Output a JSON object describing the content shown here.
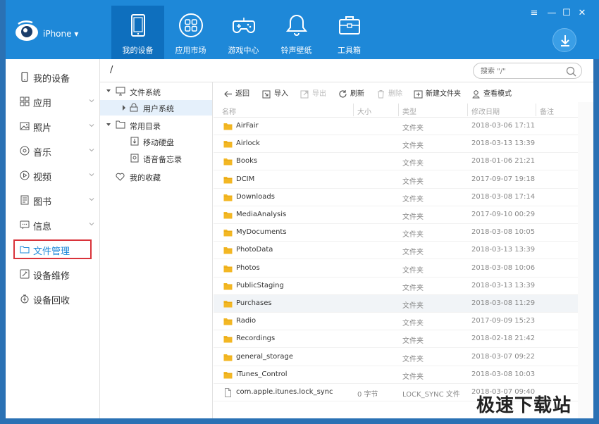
{
  "app": {
    "device_name": "iPhone ▾"
  },
  "nav_tabs": [
    {
      "label": "我的设备",
      "icon": "tablet-icon",
      "active": true
    },
    {
      "label": "应用市场",
      "icon": "apps-icon",
      "active": false
    },
    {
      "label": "游戏中心",
      "icon": "gamepad-icon",
      "active": false
    },
    {
      "label": "铃声壁纸",
      "icon": "bell-icon",
      "active": false
    },
    {
      "label": "工具箱",
      "icon": "toolbox-icon",
      "active": false
    }
  ],
  "window_controls": {
    "menu": "≡",
    "minimize": "—",
    "maximize": "☐",
    "close": "✕"
  },
  "sidebar": {
    "items": [
      {
        "label": "我的设备",
        "icon": "phone-icon",
        "has_chevron": false
      },
      {
        "label": "应用",
        "icon": "grid-icon",
        "has_chevron": true
      },
      {
        "label": "照片",
        "icon": "image-icon",
        "has_chevron": true
      },
      {
        "label": "音乐",
        "icon": "music-icon",
        "has_chevron": true
      },
      {
        "label": "视频",
        "icon": "play-icon",
        "has_chevron": true
      },
      {
        "label": "图书",
        "icon": "book-icon",
        "has_chevron": true
      },
      {
        "label": "信息",
        "icon": "message-icon",
        "has_chevron": true
      },
      {
        "label": "文件管理",
        "icon": "folder-icon",
        "has_chevron": false,
        "selected": true
      },
      {
        "label": "设备维修",
        "icon": "repair-icon",
        "has_chevron": false
      },
      {
        "label": "设备回收",
        "icon": "recycle-icon",
        "has_chevron": false
      }
    ]
  },
  "path": {
    "current": "/"
  },
  "search": {
    "placeholder": "搜索 \"/\""
  },
  "tree": {
    "file_system": "文件系统",
    "user_system": "用户系统",
    "common_dirs": "常用目录",
    "mobile_disk": "移动硬盘",
    "voice_memo": "语音备忘录",
    "favorites": "我的收藏"
  },
  "toolbar": {
    "back": "返回",
    "import": "导入",
    "export": "导出",
    "refresh": "刷新",
    "delete": "删除",
    "new_folder": "新建文件夹",
    "view_mode": "查看模式"
  },
  "table": {
    "columns": {
      "name": "名称",
      "size": "大小",
      "type": "类型",
      "modified": "修改日期",
      "note": "备注"
    },
    "rows": [
      {
        "name": "AirFair",
        "size": "",
        "type": "文件夹",
        "modified": "2018-03-06 17:11",
        "kind": "folder"
      },
      {
        "name": "Airlock",
        "size": "",
        "type": "文件夹",
        "modified": "2018-03-13 13:39",
        "kind": "folder"
      },
      {
        "name": "Books",
        "size": "",
        "type": "文件夹",
        "modified": "2018-01-06 21:21",
        "kind": "folder"
      },
      {
        "name": "DCIM",
        "size": "",
        "type": "文件夹",
        "modified": "2017-09-07 19:18",
        "kind": "folder"
      },
      {
        "name": "Downloads",
        "size": "",
        "type": "文件夹",
        "modified": "2018-03-08 17:14",
        "kind": "folder"
      },
      {
        "name": "MediaAnalysis",
        "size": "",
        "type": "文件夹",
        "modified": "2017-09-10 00:29",
        "kind": "folder"
      },
      {
        "name": "MyDocuments",
        "size": "",
        "type": "文件夹",
        "modified": "2018-03-08 10:05",
        "kind": "folder"
      },
      {
        "name": "PhotoData",
        "size": "",
        "type": "文件夹",
        "modified": "2018-03-13 13:39",
        "kind": "folder"
      },
      {
        "name": "Photos",
        "size": "",
        "type": "文件夹",
        "modified": "2018-03-08 10:06",
        "kind": "folder"
      },
      {
        "name": "PublicStaging",
        "size": "",
        "type": "文件夹",
        "modified": "2018-03-13 13:39",
        "kind": "folder"
      },
      {
        "name": "Purchases",
        "size": "",
        "type": "文件夹",
        "modified": "2018-03-08 11:29",
        "kind": "folder",
        "highlighted": true
      },
      {
        "name": "Radio",
        "size": "",
        "type": "文件夹",
        "modified": "2017-09-09 15:23",
        "kind": "folder"
      },
      {
        "name": "Recordings",
        "size": "",
        "type": "文件夹",
        "modified": "2018-02-18 21:42",
        "kind": "folder"
      },
      {
        "name": "general_storage",
        "size": "",
        "type": "文件夹",
        "modified": "2018-03-07 09:22",
        "kind": "folder"
      },
      {
        "name": "iTunes_Control",
        "size": "",
        "type": "文件夹",
        "modified": "2018-03-08 10:03",
        "kind": "folder"
      },
      {
        "name": "com.apple.itunes.lock_sync",
        "size": "0 字节",
        "type": "LOCK_SYNC 文件",
        "modified": "2018-03-07 09:40",
        "kind": "file"
      }
    ]
  },
  "watermark": "极速下载站",
  "colors": {
    "header": "#1e88d8",
    "active_tab": "#0e6fbe",
    "folder": "#f3b723",
    "selection_border": "#d9333a"
  }
}
